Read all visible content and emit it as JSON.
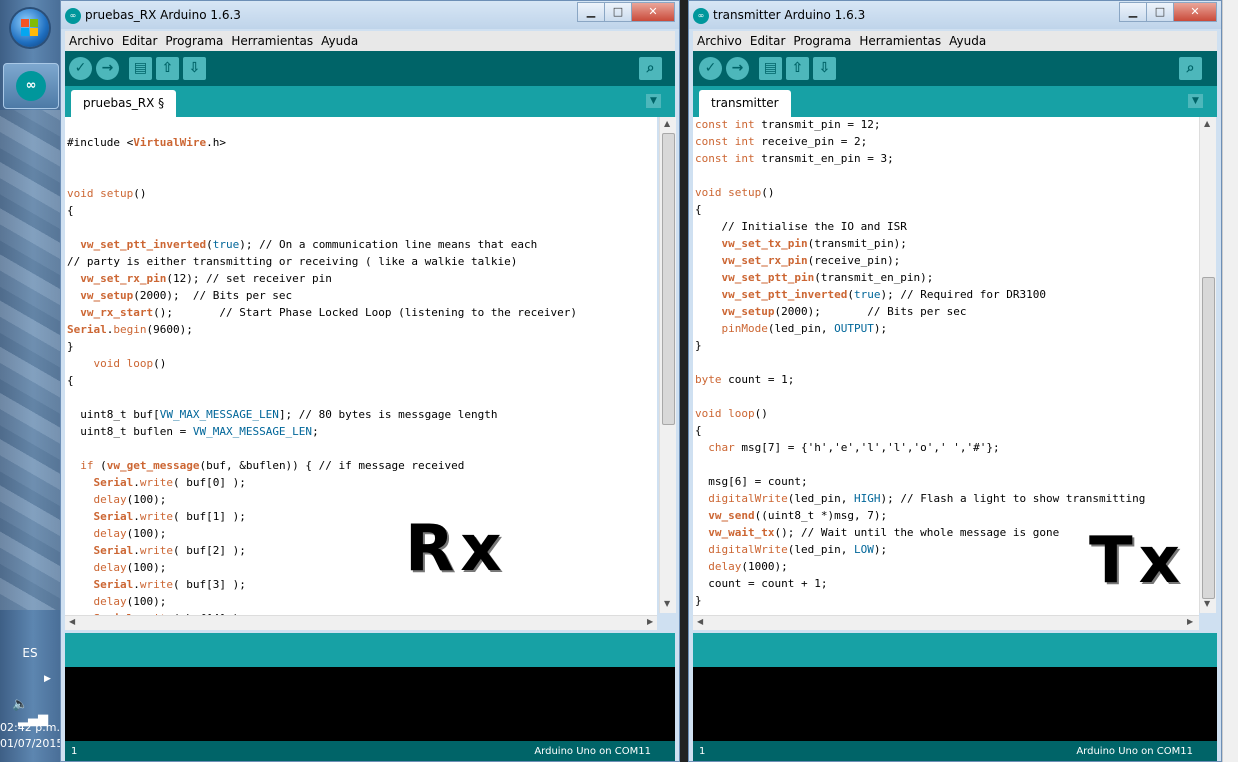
{
  "taskbar": {
    "language": "ES",
    "time": "02:42 p.m.",
    "date": "01/07/2015"
  },
  "colors": {
    "toolbar": "#006468",
    "tabbar": "#17a1a5",
    "keyword": "#cc6633",
    "constant": "#006699",
    "console": "#000000"
  },
  "windows": {
    "rx": {
      "title": "pruebas_RX Arduino 1.6.3",
      "menu": [
        "Archivo",
        "Editar",
        "Programa",
        "Herramientas",
        "Ayuda"
      ],
      "tab": "pruebas_RX §",
      "status_line": "1",
      "status_board": "Arduino Uno on COM11",
      "overlay_label": "Rx"
    },
    "tx": {
      "title": "transmitter Arduino 1.6.3",
      "menu": [
        "Archivo",
        "Editar",
        "Programa",
        "Herramientas",
        "Ayuda"
      ],
      "tab": "transmitter",
      "status_line": "1",
      "status_board": "Arduino Uno on COM11",
      "overlay_label": "Tx"
    }
  },
  "window_controls": [
    "minimize-button",
    "maximize-button",
    "close-button"
  ],
  "toolbar_icons": [
    "verify-icon",
    "upload-icon",
    "new-icon",
    "open-icon",
    "save-icon",
    "serial-monitor-icon"
  ]
}
